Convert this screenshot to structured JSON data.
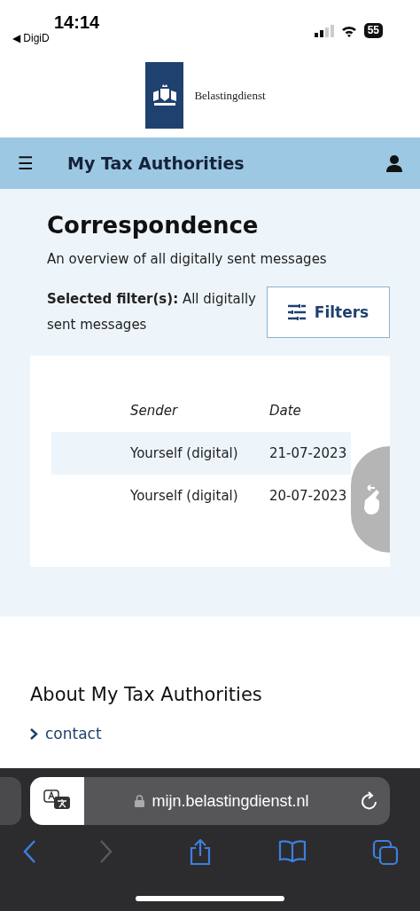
{
  "status_bar": {
    "time": "14:14",
    "back_app": "◀ DigiD",
    "battery": "55"
  },
  "header": {
    "brand": "Belastingdienst"
  },
  "nav": {
    "menu": "☰",
    "title": "My Tax Authorities"
  },
  "correspondence": {
    "title": "Correspondence",
    "subtitle": "An overview of all digitally sent messages",
    "filter_label": "Selected filter(s):",
    "filter_value": "All digitally sent messages",
    "filters_button": "Filters",
    "columns": [
      "Sender",
      "Date"
    ],
    "rows": [
      {
        "sender": "Yourself (digital)",
        "date": "21-07-2023",
        "selected": true
      },
      {
        "sender": "Yourself (digital)",
        "date": "20-07-2023",
        "selected": false
      }
    ]
  },
  "about": {
    "title": "About My Tax Authorities",
    "links": [
      "contact"
    ]
  },
  "browser": {
    "url": "mijn.belastingdienst.nl"
  }
}
